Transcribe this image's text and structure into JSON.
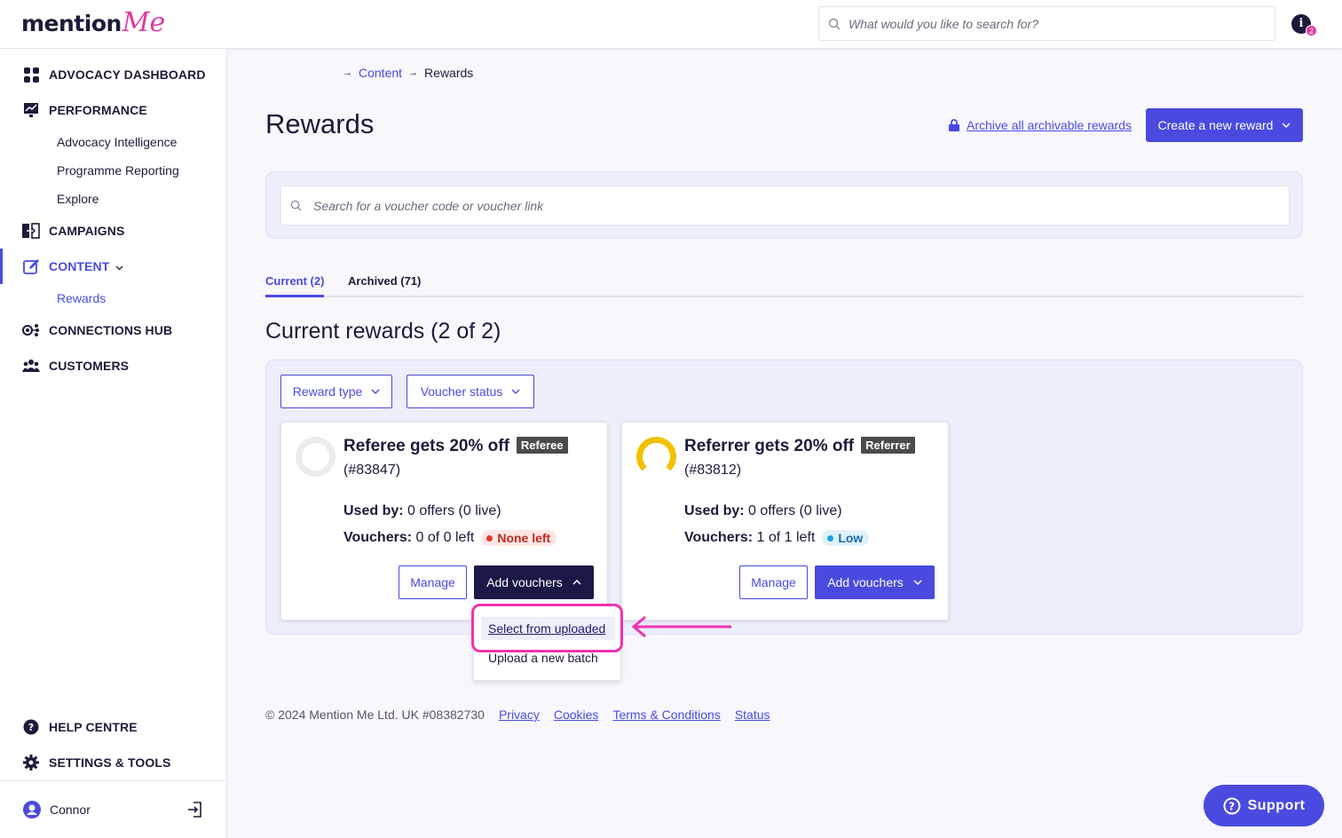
{
  "brand": {
    "logo_main": "mention",
    "logo_accent": "Me",
    "accent_color": "#e03b9e",
    "primary_color": "#4a4ae0"
  },
  "topbar": {
    "search_placeholder": "What would you like to search for?",
    "info_icon": "i",
    "notification_count": "2"
  },
  "sidebar": {
    "advocacy_dashboard": "ADVOCACY DASHBOARD",
    "performance": "PERFORMANCE",
    "performance_items": [
      "Advocacy Intelligence",
      "Programme Reporting",
      "Explore"
    ],
    "campaigns": "CAMPAIGNS",
    "content": "CONTENT",
    "content_items": [
      "Rewards"
    ],
    "connections_hub": "CONNECTIONS HUB",
    "customers": "CUSTOMERS",
    "help_centre": "HELP CENTRE",
    "settings_tools": "SETTINGS & TOOLS",
    "user_name": "Connor"
  },
  "breadcrumb": {
    "link": "Content",
    "current": "Rewards"
  },
  "page": {
    "title": "Rewards",
    "archive_link": "Archive all archivable rewards",
    "create_button": "Create a new reward",
    "voucher_search_placeholder": "Search for a voucher code or voucher link"
  },
  "tabs": [
    {
      "label": "Current (2)",
      "active": true
    },
    {
      "label": "Archived (71)",
      "active": false
    }
  ],
  "section_title": "Current rewards (2 of 2)",
  "filters": {
    "reward_type": "Reward type",
    "voucher_status": "Voucher status"
  },
  "cards": [
    {
      "title": "Referee gets 20% off",
      "badge": "Referee",
      "id": "(#83847)",
      "used_label": "Used by:",
      "used_value": " 0 offers (0 live)",
      "vouchers_label": "Vouchers:",
      "vouchers_value": " 0 of 0 left",
      "status": "None left",
      "manage": "Manage",
      "add_vouchers": "Add vouchers"
    },
    {
      "title": "Referrer gets 20% off",
      "badge": "Referrer",
      "id": "(#83812)",
      "used_label": "Used by:",
      "used_value": " 0 offers (0 live)",
      "vouchers_label": "Vouchers:",
      "vouchers_value": " 1 of 1 left",
      "status": "Low",
      "manage": "Manage",
      "add_vouchers": "Add vouchers"
    }
  ],
  "dropdown": {
    "items": [
      "Select from uploaded",
      "Upload a new batch"
    ]
  },
  "footer": {
    "copyright": "© 2024 Mention Me Ltd. UK #08382730",
    "links": [
      "Privacy",
      "Cookies",
      "Terms & Conditions",
      "Status"
    ]
  },
  "support_button": "Support"
}
